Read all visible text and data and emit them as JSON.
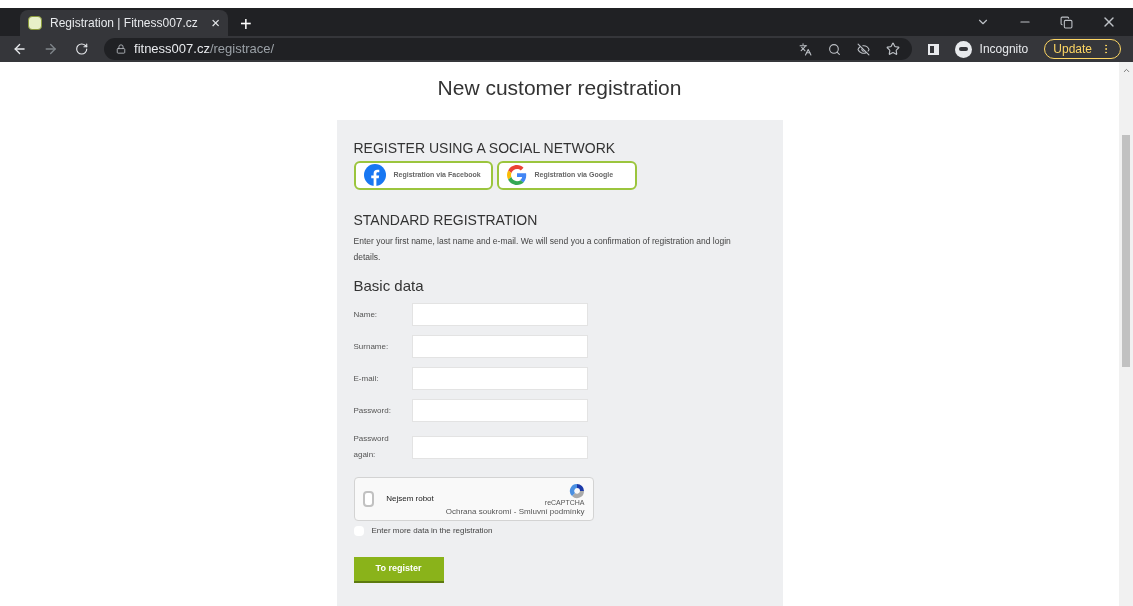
{
  "browser": {
    "tab_title": "Registration | Fitness007.cz",
    "tab_close": "×",
    "new_tab": "+",
    "url_domain": "fitness007.cz",
    "url_path": "/registrace/",
    "profile": "Incognito",
    "update": "Update"
  },
  "page": {
    "title": "New customer registration",
    "social": {
      "heading": "REGISTER USING A SOCIAL NETWORK",
      "buttons": [
        {
          "kind": "facebook",
          "label": "Registration via Facebook"
        },
        {
          "kind": "google",
          "label": "Registration via Google"
        }
      ]
    },
    "standard": {
      "heading": "STANDARD REGISTRATION",
      "description": "Enter your first name, last name and e-mail. We will send you a confirmation of registration and login details."
    },
    "basic_data": {
      "heading": "Basic data",
      "fields": [
        {
          "label": "Name:"
        },
        {
          "label": "Surname:"
        },
        {
          "label": "E-mail:"
        },
        {
          "label": "Password:"
        },
        {
          "label": "Password again:"
        }
      ]
    },
    "captcha": {
      "label": "Nejsem robot",
      "checked": false,
      "brand": "reCAPTCHA",
      "links": "Ochrana soukromí - Smluvní podmínky"
    },
    "more_data": {
      "label": "Enter more data in the registration",
      "checked": false
    },
    "submit": "To register"
  }
}
